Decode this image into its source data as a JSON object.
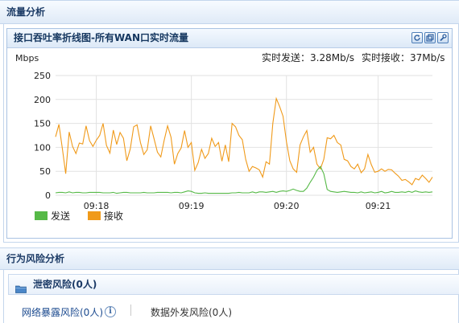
{
  "sections": {
    "traffic_title": "流量分析",
    "behavior_title": "行为风险分析"
  },
  "chart_panel": {
    "title": "接口吞吐率折线图-所有WAN口实时流量",
    "tools": [
      {
        "name": "refresh-icon"
      },
      {
        "name": "window-icon"
      },
      {
        "name": "settings-wrench-icon"
      }
    ]
  },
  "realtime": {
    "send_text": "实时发送：3.28Mb/s",
    "recv_text": "实时接收：37Mb/s"
  },
  "colors": {
    "send": "#56b947",
    "recv": "#f09a1a",
    "grid": "#e2e2e2"
  },
  "chart_data": {
    "type": "line",
    "ylabel": "Mbps",
    "ylim": [
      0,
      250
    ],
    "yticks": [
      0,
      50,
      100,
      150,
      200,
      250
    ],
    "x_ticks": [
      {
        "label": "09:18",
        "index": 12
      },
      {
        "label": "09:19",
        "index": 40
      },
      {
        "label": "09:20",
        "index": 68
      },
      {
        "label": "09:21",
        "index": 95
      }
    ],
    "num_points": 112,
    "legend_position": "bottom-left",
    "series": [
      {
        "name": "发送",
        "color": "#56b947",
        "values": [
          5,
          6,
          6,
          5,
          7,
          5,
          6,
          6,
          5,
          5,
          6,
          6,
          6,
          6,
          5,
          5,
          5,
          6,
          4,
          5,
          6,
          6,
          5,
          5,
          5,
          5,
          6,
          5,
          5,
          5,
          6,
          6,
          6,
          6,
          5,
          6,
          6,
          5,
          7,
          9,
          8,
          5,
          4,
          4,
          5,
          4,
          4,
          4,
          4,
          4,
          4,
          4,
          5,
          5,
          6,
          5,
          5,
          5,
          7,
          5,
          7,
          7,
          6,
          7,
          8,
          6,
          8,
          9,
          8,
          10,
          13,
          10,
          8,
          8,
          15,
          27,
          38,
          52,
          60,
          45,
          12,
          8,
          7,
          6,
          7,
          8,
          7,
          6,
          6,
          5,
          7,
          5,
          6,
          7,
          5,
          6,
          8,
          5,
          6,
          8,
          6,
          6,
          7,
          6,
          8,
          6,
          9,
          7,
          6,
          7,
          6,
          7
        ]
      },
      {
        "name": "接收",
        "color": "#f09a1a",
        "values": [
          122,
          148,
          98,
          45,
          132,
          102,
          87,
          109,
          107,
          145,
          114,
          102,
          115,
          125,
          150,
          104,
          88,
          136,
          106,
          131,
          119,
          72,
          97,
          143,
          147,
          110,
          85,
          95,
          145,
          118,
          90,
          80,
          115,
          145,
          121,
          65,
          87,
          99,
          135,
          100,
          110,
          52,
          68,
          96,
          77,
          87,
          119,
          102,
          110,
          71,
          105,
          70,
          150,
          143,
          125,
          116,
          75,
          50,
          60,
          57,
          53,
          38,
          70,
          65,
          150,
          202,
          185,
          165,
          112,
          72,
          55,
          48,
          105,
          122,
          135,
          90,
          100,
          65,
          55,
          75,
          120,
          118,
          125,
          110,
          105,
          75,
          72,
          60,
          55,
          65,
          47,
          55,
          85,
          64,
          48,
          50,
          55,
          50,
          54,
          53,
          46,
          40,
          31,
          33,
          28,
          22,
          35,
          32,
          42,
          35,
          27,
          38
        ]
      }
    ]
  },
  "risk": {
    "leak_header": "泄密风险(0人)",
    "network_exposure": "网络暴露风险(0人)",
    "info_glyph": "i",
    "data_outbound": "数据外发风险(0人)"
  }
}
